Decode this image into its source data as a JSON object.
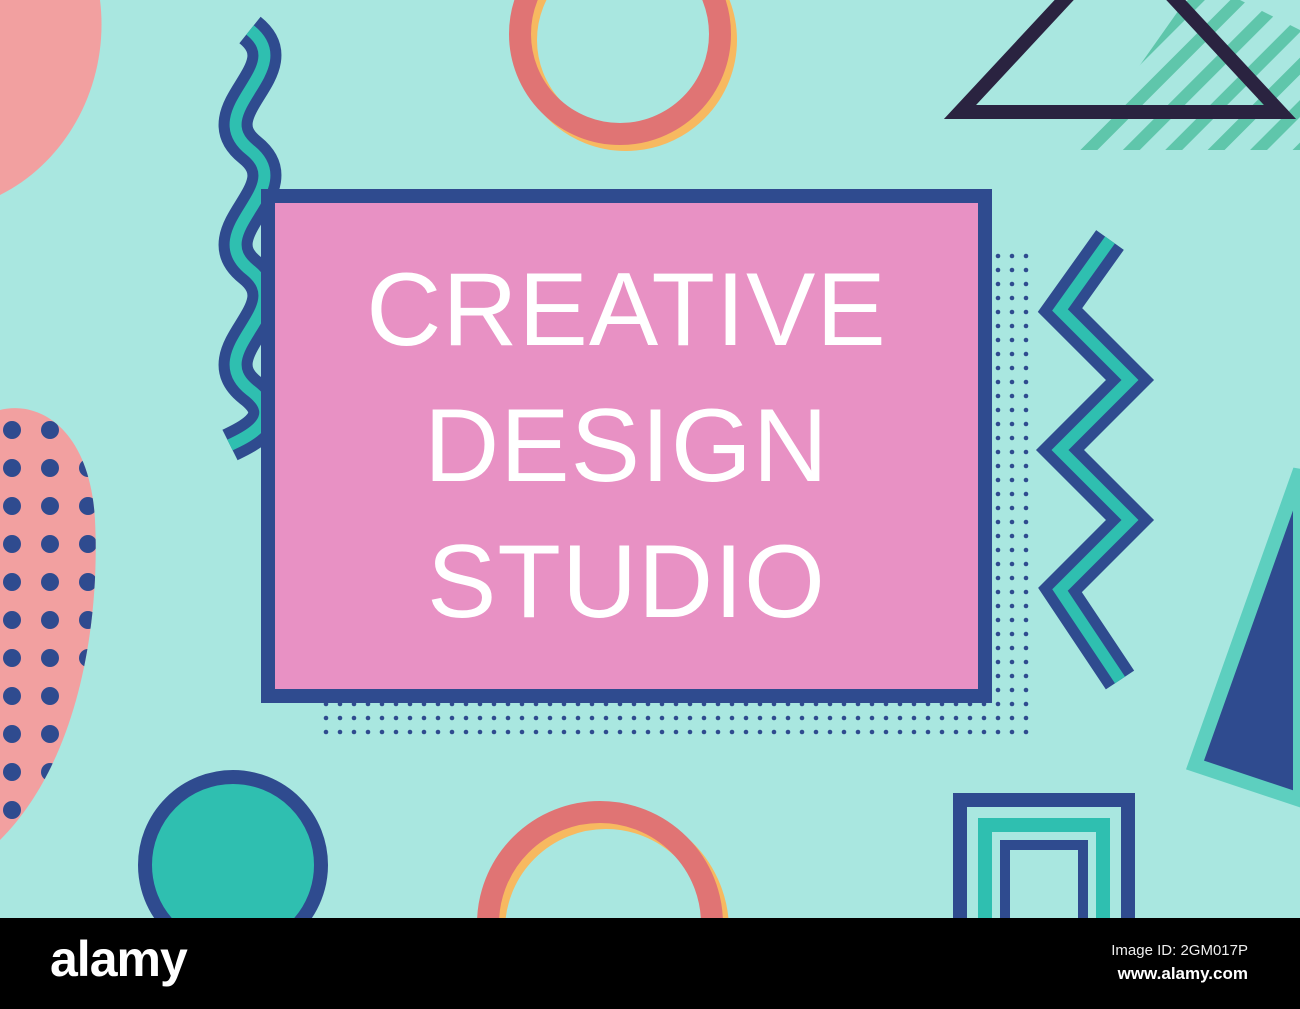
{
  "headline": {
    "line1": "CREATIVE",
    "line2": "DESIGN",
    "line3": "STUDIO"
  },
  "footer": {
    "logo": "alamy",
    "image_id": "Image ID: 2GM017P",
    "url": "www.alamy.com"
  },
  "colors": {
    "background": "#a9e7e0",
    "panel": "#e891c4",
    "navy": "#2f4b8f",
    "teal": "#2fbfb0",
    "coral": "#e07474",
    "yellow": "#f7b960",
    "pink": "#f2a0a0"
  }
}
